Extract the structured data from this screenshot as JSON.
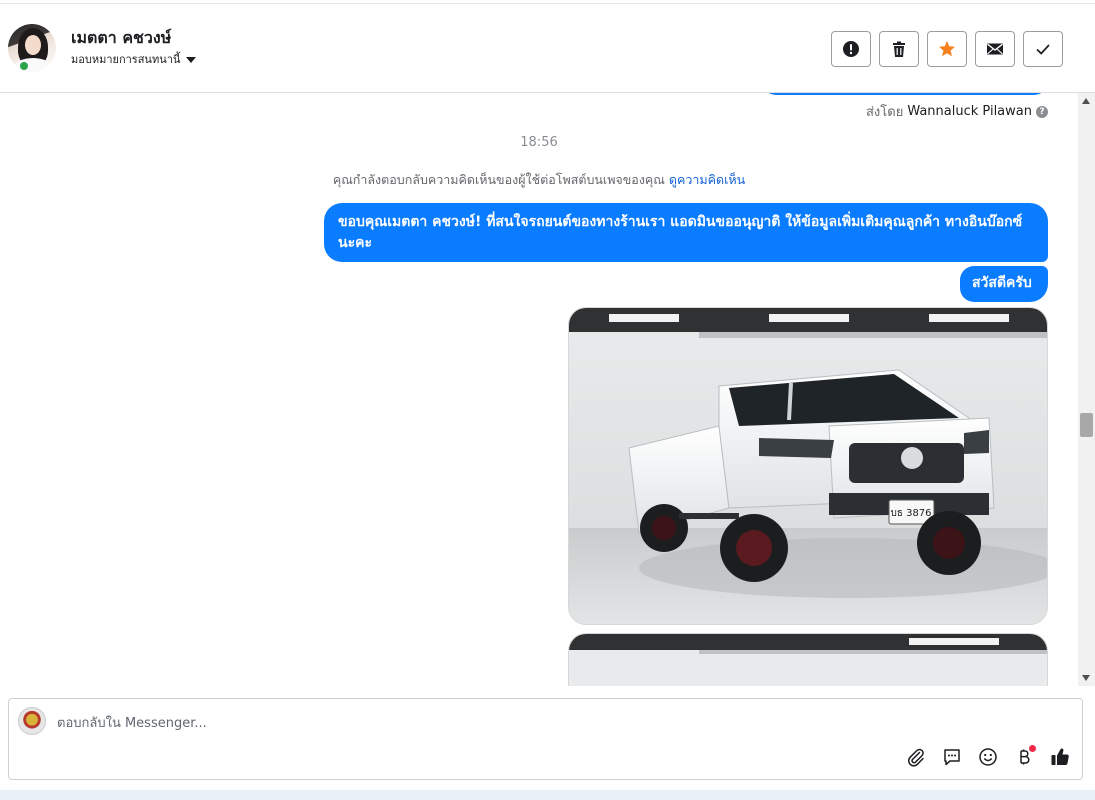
{
  "header": {
    "contact_name": "เมตตา คชวงษ์",
    "assign_label": "มอบหมายการสนทนานี้",
    "actions": [
      {
        "name": "spam-button",
        "icon": "exclamation-icon"
      },
      {
        "name": "delete-button",
        "icon": "trash-icon"
      },
      {
        "name": "star-button",
        "icon": "star-icon",
        "color": "#f5821f"
      },
      {
        "name": "mark-unread-button",
        "icon": "envelope-icon"
      },
      {
        "name": "done-button",
        "icon": "check-icon"
      }
    ]
  },
  "conversation": {
    "sent_by_prefix": "ส่งโดย",
    "sent_by_name": "Wannaluck Pilawan",
    "timestamp": "18:56",
    "notice_text": "คุณกำลังตอบกลับความคิดเห็นของผู้ใช้ต่อโพสต์บนเพจของคุณ",
    "notice_link": "ดูความคิดเห็น",
    "messages": [
      {
        "text": "ขอบคุณเมตตา คชวงษ์! ที่สนใจรถยนต์ของทางร้านเรา แอดมินขออนุญาติ ให้ข้อมูลเพิ่มเติมคุณลูกค้า ทางอินบ๊อกซ์นะคะ"
      },
      {
        "text": "สวัสดีครับ"
      }
    ],
    "photo_plate": "บธ 3876",
    "bubble_color": "#0a7cff"
  },
  "composer": {
    "placeholder": "ตอบกลับใน Messenger...",
    "tools": [
      "paperclip-icon",
      "saved-reply-icon",
      "emoji-icon",
      "baht-payment-icon",
      "thumbs-up-icon"
    ]
  }
}
